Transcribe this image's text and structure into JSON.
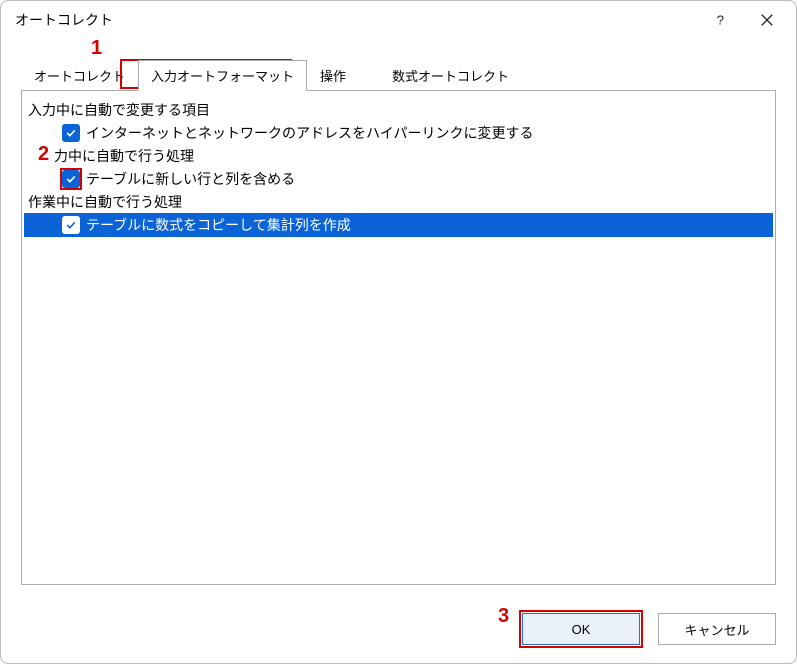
{
  "window": {
    "title": "オートコレクト"
  },
  "tabs": {
    "items": [
      {
        "label": "オートコレクト"
      },
      {
        "label": "入力オートフォーマット"
      },
      {
        "label": "操作"
      },
      {
        "label": "数式オートコレクト"
      }
    ]
  },
  "sections": {
    "s1": "入力中に自動で変更する項目",
    "s2": "力中に自動で行う処理",
    "s3": "作業中に自動で行う処理"
  },
  "options": {
    "o1": "インターネットとネットワークのアドレスをハイパーリンクに変更する",
    "o2": "テーブルに新しい行と列を含める",
    "o3": "テーブルに数式をコピーして集計列を作成"
  },
  "buttons": {
    "ok": "OK",
    "cancel": "キャンセル"
  },
  "markers": {
    "m1": "1",
    "m2": "2",
    "m3": "3"
  }
}
